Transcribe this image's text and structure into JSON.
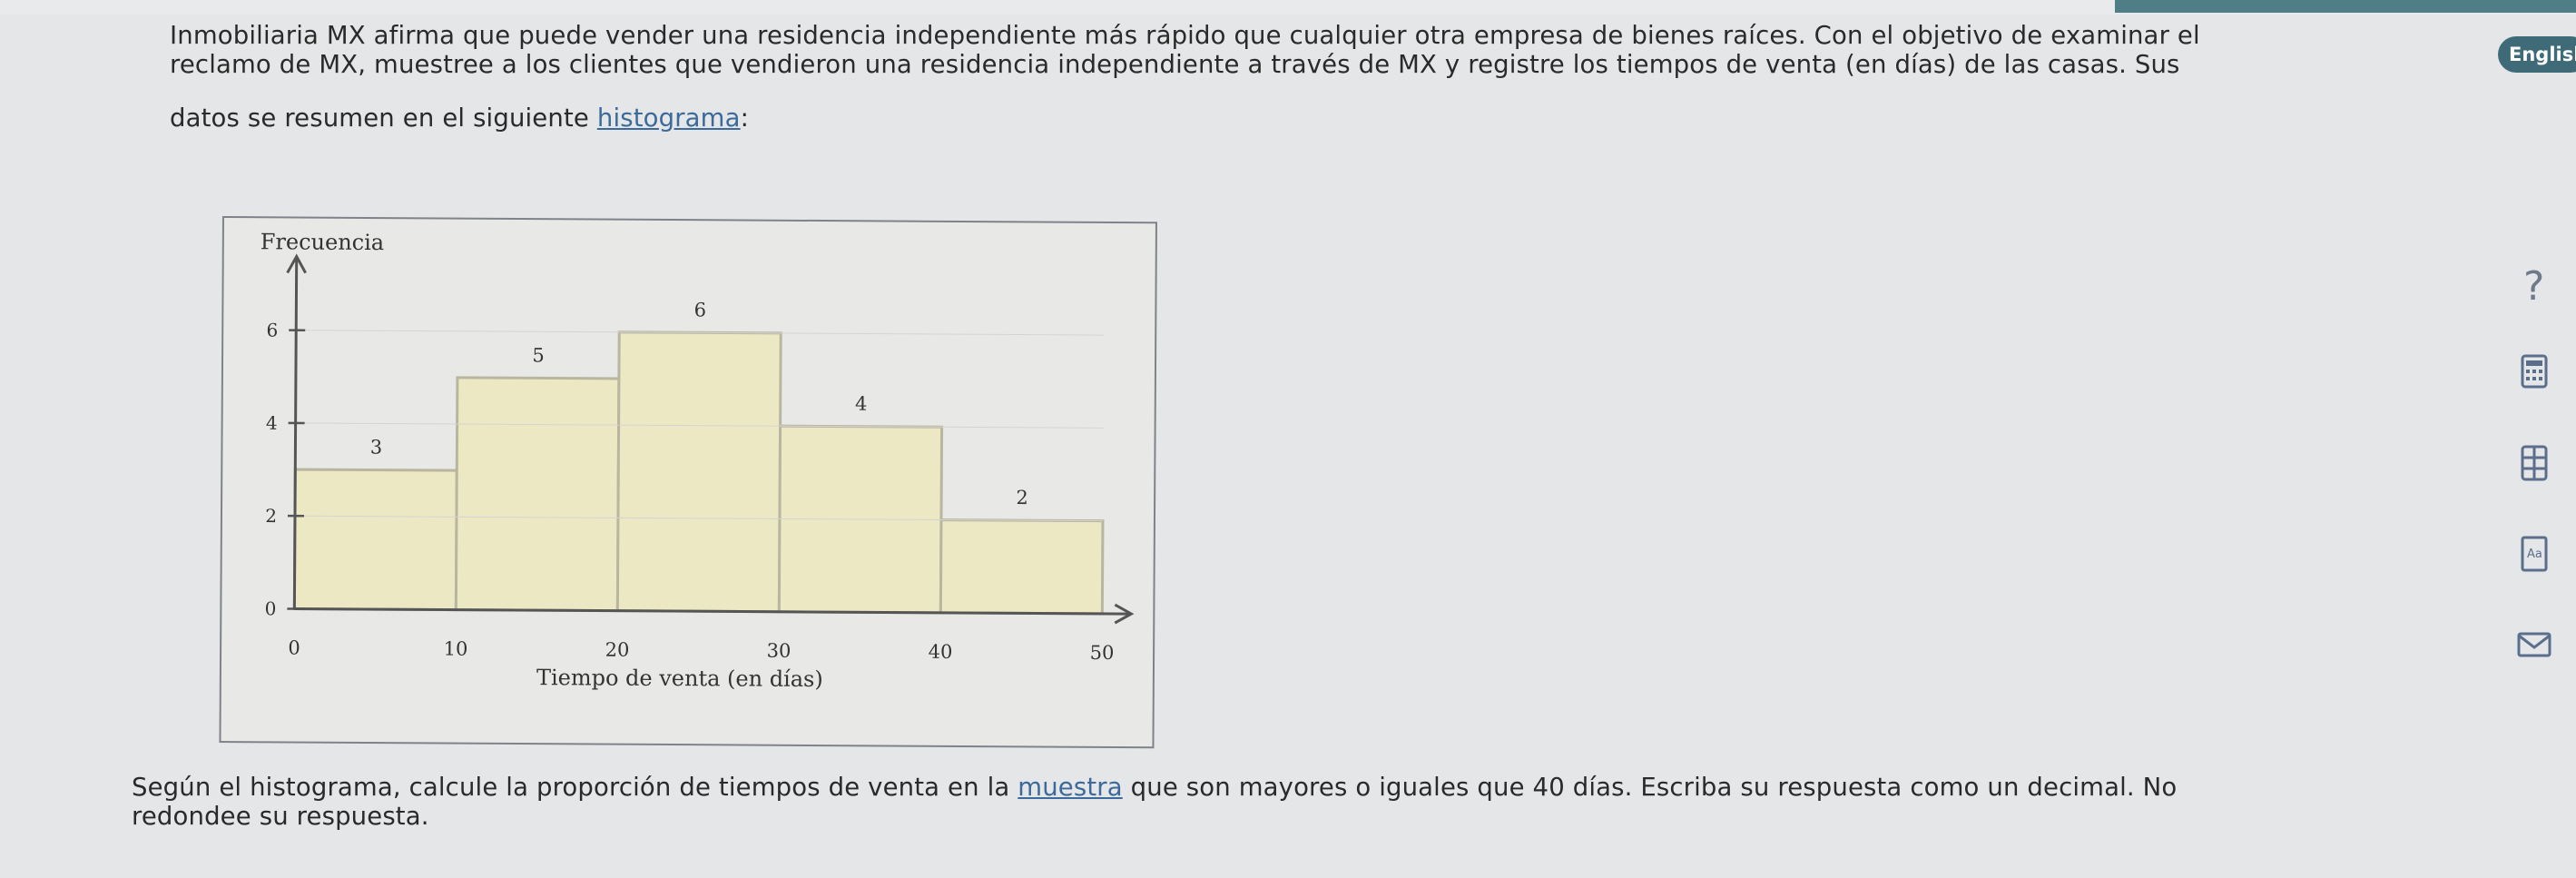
{
  "header": {
    "language_button": "English"
  },
  "problem": {
    "intro_line1": "Inmobiliaria MX afirma que puede vender una residencia independiente más rápido que cualquier otra empresa de bienes raíces. Con el objetivo de examinar el",
    "intro_line2": "reclamo de MX, muestree a los clientes que vendieron una residencia independiente a través de MX y registre los tiempos de venta (en días) de las casas. Sus",
    "intro_line3_pre": "datos se resumen en el siguiente ",
    "intro_link": "histograma",
    "intro_line3_post": ":",
    "question_line1_pre": "Según el histograma, calcule la proporción de tiempos de venta en la ",
    "question_link": "muestra",
    "question_line1_post": " que son mayores o iguales que 40 días. Escriba su respuesta como un decimal. No",
    "question_line2": "redondee su respuesta."
  },
  "sidebar": {
    "icons": [
      "help-icon",
      "calculator-icon",
      "data-table-icon",
      "textbook-icon",
      "message-icon"
    ],
    "help_glyph": "?"
  },
  "chart_data": {
    "type": "bar",
    "histogram": true,
    "bins": [
      [
        0,
        10
      ],
      [
        10,
        20
      ],
      [
        20,
        30
      ],
      [
        30,
        40
      ],
      [
        40,
        50
      ]
    ],
    "values": [
      3,
      5,
      6,
      4,
      2
    ],
    "data_labels": [
      "3",
      "5",
      "6",
      "4",
      "2"
    ],
    "ylabel": "Frecuencia",
    "xlabel": "Tiempo de venta (en días)",
    "x_ticks": [
      "0",
      "10",
      "20",
      "30",
      "40",
      "50"
    ],
    "y_ticks": [
      "0",
      "2",
      "4",
      "6"
    ],
    "ylim": [
      0,
      7
    ],
    "xlim": [
      0,
      50
    ],
    "colors": {
      "bar_fill": "#ece8c4",
      "bar_stroke": "#b9b6a0",
      "axis": "#555555"
    }
  }
}
